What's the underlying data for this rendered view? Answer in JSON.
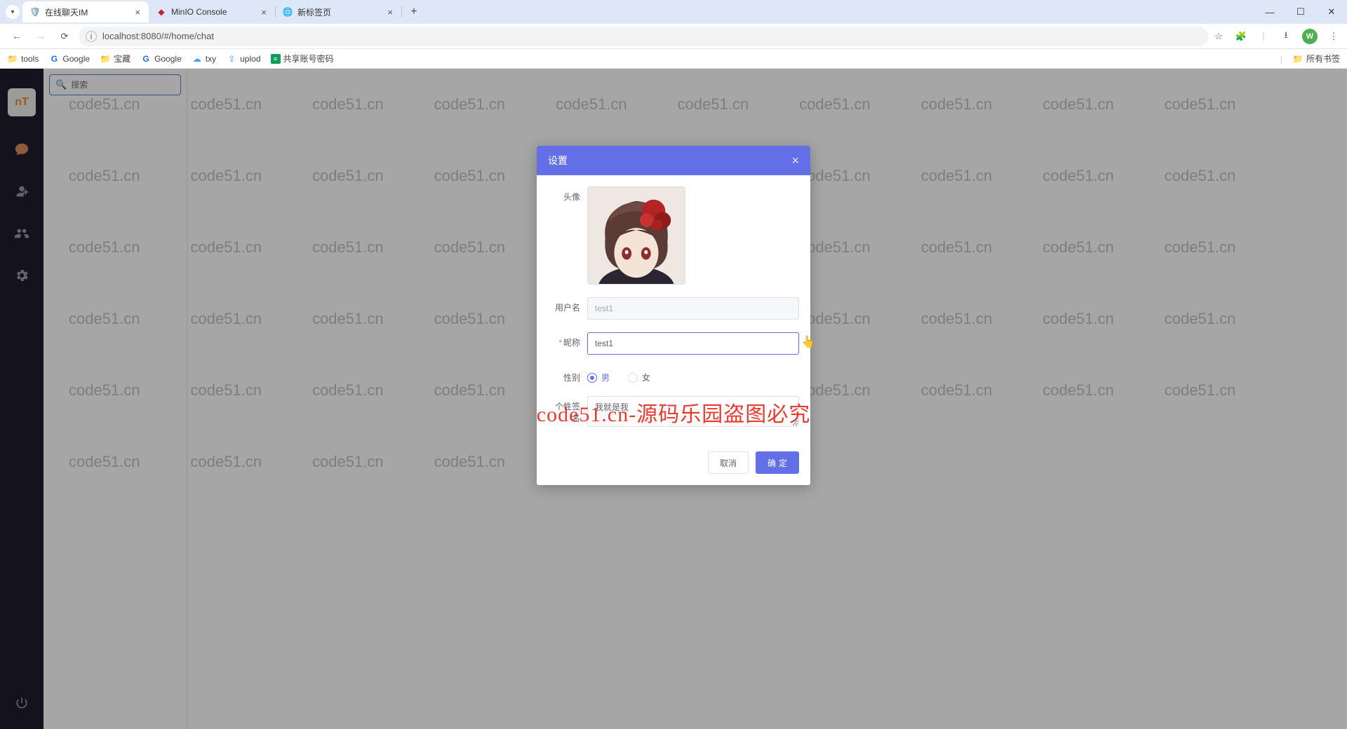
{
  "browser": {
    "tabs": [
      {
        "title": "在线聊天IM",
        "active": true
      },
      {
        "title": "MinIO Console",
        "active": false
      },
      {
        "title": "新标签页",
        "active": false
      }
    ],
    "url": "localhost:8080/#/home/chat",
    "bookmarks": [
      "tools",
      "Google",
      "宝藏",
      "Google",
      "txy",
      "uplod",
      "共享账号密码"
    ],
    "all_bookmarks": "所有书签",
    "profile_letter": "W"
  },
  "sidebar": {
    "avatar_text": "nT"
  },
  "search": {
    "placeholder": "搜索"
  },
  "watermark": {
    "small": "code51.cn",
    "big": "code51.cn-源码乐园盗图必究"
  },
  "modal": {
    "title": "设置",
    "labels": {
      "avatar": "头像",
      "username": "用户名",
      "nickname": "昵称",
      "gender": "性别",
      "signature": "个性签名"
    },
    "values": {
      "username": "test1",
      "nickname": "test1",
      "signature": "我就是我"
    },
    "gender": {
      "male": "男",
      "female": "女",
      "selected": "male"
    },
    "buttons": {
      "cancel": "取消",
      "ok": "确定"
    }
  }
}
